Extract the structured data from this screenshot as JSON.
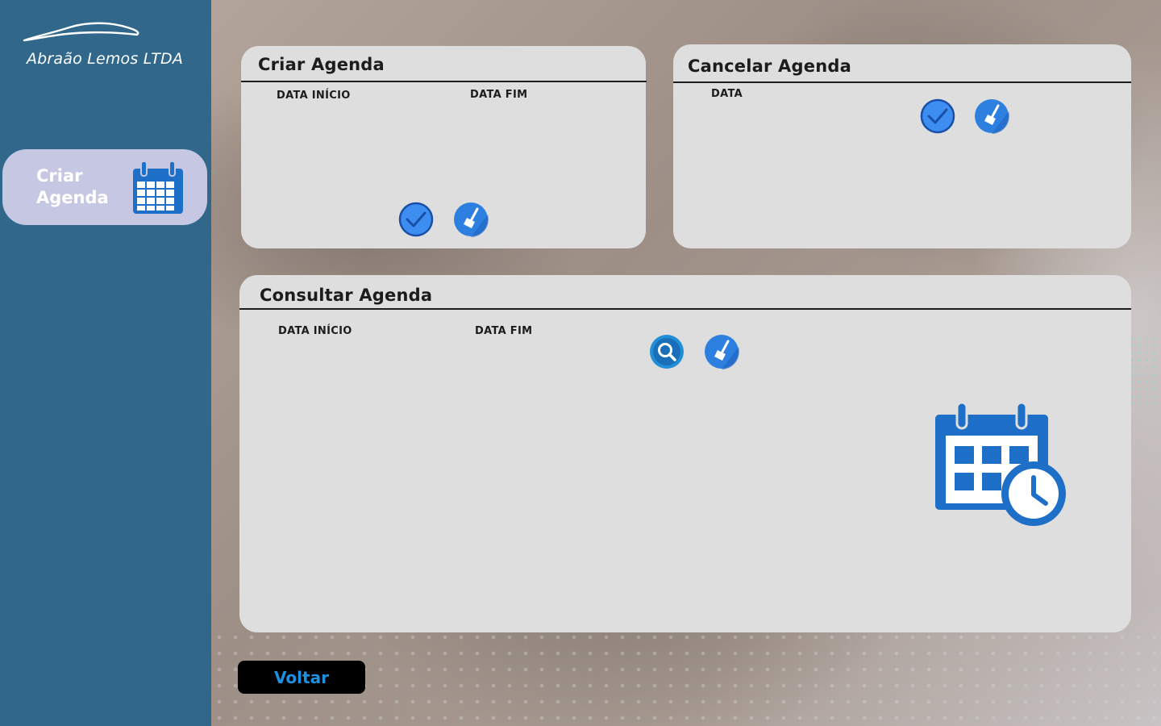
{
  "company": {
    "name": "Abraão Lemos LTDA"
  },
  "sidebar": {
    "active_item": {
      "label": "Criar Agenda",
      "icon": "calendar-icon"
    }
  },
  "criar_agenda": {
    "title": "Criar Agenda",
    "labels": {
      "start": "DATA INÍCIO",
      "end": "DATA FIM"
    },
    "confirm_icon": "check-icon",
    "clear_icon": "broom-icon"
  },
  "cancelar_agenda": {
    "title": "Cancelar Agenda",
    "labels": {
      "date": "DATA"
    },
    "confirm_icon": "check-icon",
    "clear_icon": "broom-icon"
  },
  "consultar_agenda": {
    "title": "Consultar Agenda",
    "labels": {
      "start": "DATA INÍCIO",
      "end": "DATA FIM"
    },
    "search_icon": "search-icon",
    "clear_icon": "broom-icon",
    "illustration_icon": "calendar-clock-icon"
  },
  "footer": {
    "back_label": "Voltar"
  },
  "colors": {
    "sidebar": "#30678a",
    "side_card": "#c6c7e2",
    "panel": "#dedede",
    "icon_blue": "#1e6fc8",
    "button_blue": "#2d7fe0",
    "back_text": "#1e90e0"
  }
}
